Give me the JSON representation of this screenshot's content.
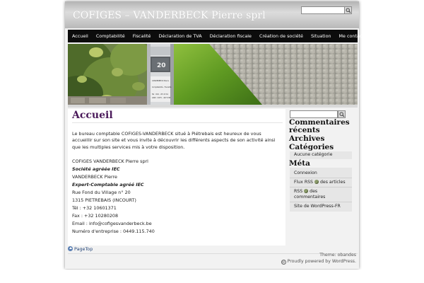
{
  "header": {
    "site_title": "COFIGES – VANDERBECK Pierre sprl",
    "search_placeholder": ""
  },
  "nav": {
    "items": [
      "Accueil",
      "Comptabilité",
      "Fiscalité",
      "Déclaration de TVA",
      "Déclaration fiscale",
      "Création de société",
      "Situation",
      "Me contacter"
    ]
  },
  "banner": {
    "number_sign": "20",
    "plaque_lines": [
      "VANDERBECK Pierre",
      "Comptabilité - Fiscalité",
      "Tel : 010 - 65 13 61",
      "GSM : 0475 - 407 038"
    ]
  },
  "content": {
    "title": "Accueil",
    "intro": "Le bureau comptable COFIGES-VANDERBECK situé à Piétrebais est heureux de vous accueillir sur son site et vous invite à découvrir les différents aspects de son activité ainsi que les multiples services mis à votre disposition.",
    "lines": [
      {
        "text": "COFIGES VANDERBECK Pierre sprl",
        "emphasis": false
      },
      {
        "text": "Société agréée IEC",
        "emphasis": true
      },
      {
        "text": "VANDERBECK Pierre",
        "emphasis": false
      },
      {
        "text": "Expert-Comptable agréé IEC",
        "emphasis": true
      },
      {
        "text": "Rue Fond du Village n° 20",
        "emphasis": false
      },
      {
        "text": "1315 PIETREBAIS (INCOURT)",
        "emphasis": false
      },
      {
        "text": "Tél : +32 10601371",
        "emphasis": false
      },
      {
        "text": "Fax : +32 10280208",
        "emphasis": false
      },
      {
        "text": "Email : info@cofigesvanderbeck.be",
        "emphasis": false
      },
      {
        "text": "Numéro d'entreprise : 0449.115.740",
        "emphasis": false
      }
    ]
  },
  "sidebar": {
    "recent_comments_heading": "Commentaires récents",
    "archives_heading": "Archives",
    "categories_heading": "Catégories",
    "categories": [
      "Aucune catégorie"
    ],
    "meta_heading": "Méta",
    "meta_items": {
      "login": "Connexion",
      "rss_articles_prefix": "Flux RSS",
      "rss_articles_suffix": "des articles",
      "rss_comments_prefix": "RSS",
      "rss_comments_suffix": "des",
      "rss_comments_line2": "commentaires",
      "wordpress_site": "Site de WordPress-FR"
    }
  },
  "footer": {
    "page_top": "PageTop",
    "theme_credit": "Theme: obandes",
    "wp_credit": "Proudly powered by WordPress."
  },
  "colors": {
    "title_purple": "#4a1a5a",
    "nav_bg": "#0c0c0c",
    "page_bg": "#f2f2f2",
    "link_blue": "#25477a"
  }
}
